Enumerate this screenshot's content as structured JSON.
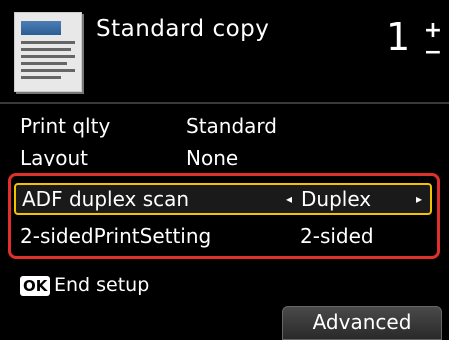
{
  "header": {
    "title": "Standard copy",
    "copies": "1",
    "stepper_plus": "+",
    "stepper_minus": "−",
    "document_icon": "document-thumbnail-icon"
  },
  "settings": [
    {
      "label": "Print qlty",
      "value": "Standard"
    },
    {
      "label": "Layout",
      "value": "None"
    },
    {
      "label": "ADF duplex scan",
      "value": "Duplex",
      "selected": true
    },
    {
      "label": "2-sidedPrintSetting",
      "value": "2-sided"
    }
  ],
  "arrows": {
    "left": "◂",
    "right": "▸"
  },
  "footer": {
    "ok_badge": "OK",
    "ok_label": "End setup",
    "advanced_label": "Advanced"
  },
  "colors": {
    "background": "#000000",
    "highlight_border": "#e0302c",
    "selection_border": "#f2c200"
  }
}
